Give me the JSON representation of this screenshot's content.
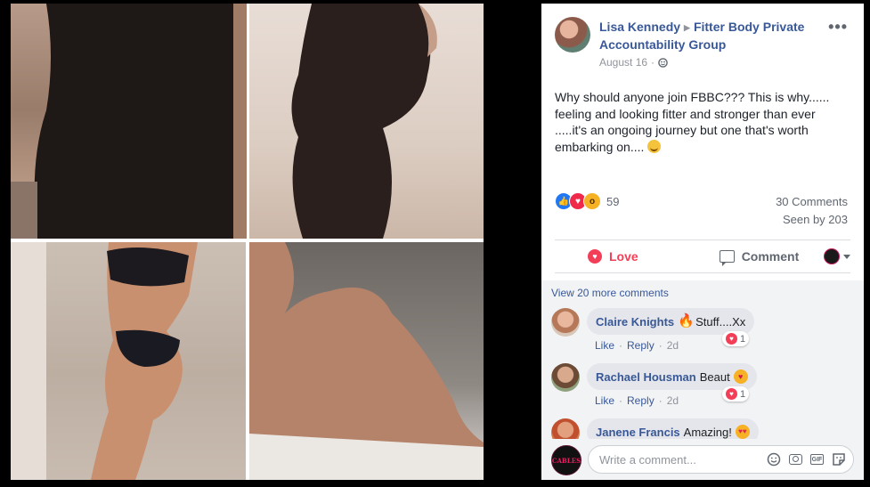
{
  "post": {
    "author": "Lisa Kennedy",
    "group": "Fitter Body Private Accountability Group",
    "date": "August 16",
    "text_line_1": "Why should anyone join FBBC??? This is why......",
    "text_line_2": "feeling and looking fitter and stronger than ever",
    "text_line_3": ".....it's an ongoing journey but one that's worth",
    "text_line_4": "embarking on....",
    "reaction_count": "59",
    "comment_count": "30 Comments",
    "seen_by": "Seen by 203"
  },
  "actions": {
    "love_label": "Love",
    "comment_label": "Comment"
  },
  "comments": {
    "view_more": "View 20 more comments",
    "like_label": "Like",
    "reply_label": "Reply",
    "items": [
      {
        "author": "Claire Knights",
        "text": "Stuff....Xx",
        "time": "2d",
        "reactions": "1",
        "emoji": "fire-icon"
      },
      {
        "author": "Rachael Housman",
        "text": "Beaut",
        "time": "2d",
        "reactions": "1",
        "emoji": "kiss-icon"
      },
      {
        "author": "Janene Francis",
        "text": "Amazing!",
        "emoji": "in-love-icon"
      }
    ]
  },
  "compose": {
    "placeholder": "Write a comment...",
    "avatar_text": "CABLES"
  },
  "colors": {
    "link": "#385898",
    "love": "#f33e58",
    "like": "#2078f4",
    "panel_bg": "#ffffff",
    "comments_bg": "#f2f3f5"
  }
}
